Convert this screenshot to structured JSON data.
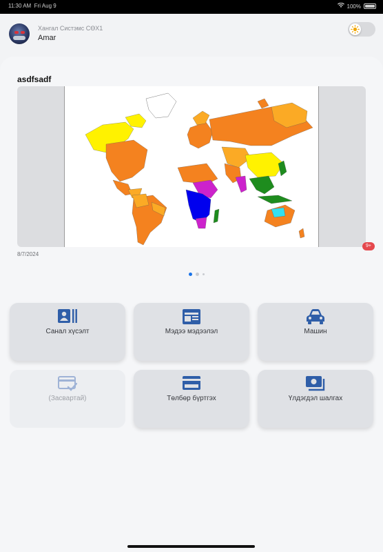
{
  "status_bar": {
    "time": "11:30 AM",
    "date": "Fri Aug 9",
    "battery": "100%"
  },
  "header": {
    "company": "Хангал Систэмс СӨХ1",
    "username": "Amar"
  },
  "news_card": {
    "title": "asdfsadf",
    "date": "8/7/2024"
  },
  "carousel": {
    "count": 3,
    "active": 0
  },
  "tiles": [
    {
      "label": "Санал хүсэлт",
      "icon": "contact-card-icon",
      "disabled": false
    },
    {
      "label": "Мэдээ мэдээлэл",
      "icon": "newspaper-icon",
      "disabled": false
    },
    {
      "label": "Машин",
      "icon": "car-icon",
      "disabled": false,
      "badge": "9+"
    },
    {
      "label": "(Засвартай)",
      "icon": "card-check-icon",
      "disabled": true
    },
    {
      "label": "Төлбөр бүртгэх",
      "icon": "credit-card-icon",
      "disabled": false
    },
    {
      "label": "Үлдэгдэл шалгах",
      "icon": "money-stack-icon",
      "disabled": false
    }
  ],
  "colors": {
    "accent": "#1a73e8",
    "icon": "#2f5ea8",
    "badge": "#e5484d"
  }
}
